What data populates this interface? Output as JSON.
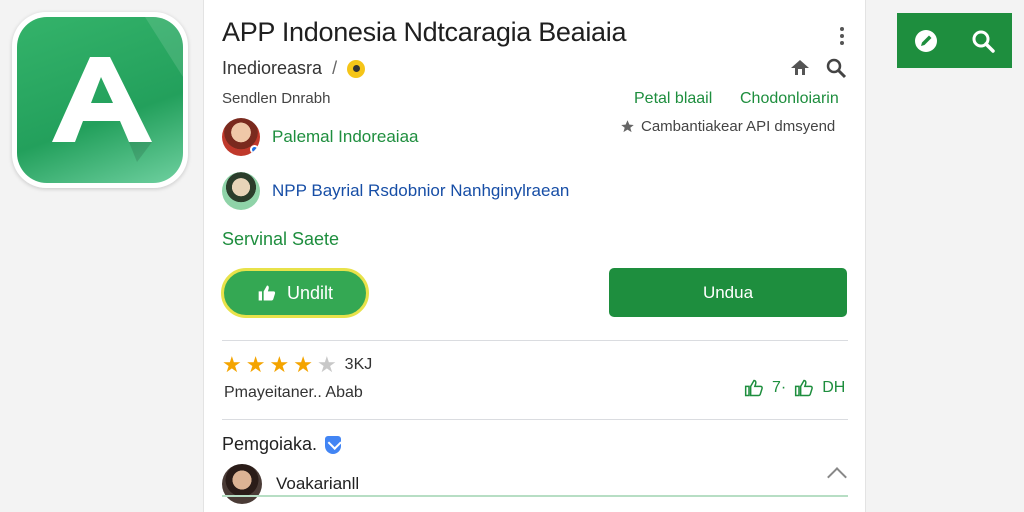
{
  "app": {
    "title": "APP Indonesia Ndtcaragia Beaiaia",
    "developer": "Inedioreasra",
    "developer_separator": "/",
    "sub_label": "Sendlen Dnrabh",
    "link_a": "Petal blaail",
    "link_b": "Chodonloiarin",
    "star_note": "Cambantiakear API dmsyend"
  },
  "people": [
    {
      "name": "Palemal Indoreaiaa"
    },
    {
      "name": "NPP Bayrial Rsdobnior Nanhginylraean"
    }
  ],
  "section": {
    "label": "Servinal Saete"
  },
  "buttons": {
    "secondary_label": "Undilt",
    "primary_label": "Undua"
  },
  "rating": {
    "stars_filled": 4,
    "stars_total": 5,
    "count": "3KJ",
    "review": "Pmayeitaner.. Abab",
    "vote_middle": "7·",
    "vote_count": "DH"
  },
  "comments": {
    "title": "Pemgoiaka.",
    "commenter": "Voakarianll"
  },
  "colors": {
    "accent": "#1e8e3e",
    "star": "#f4a400",
    "button_outline": "#e8e24a",
    "link_blue": "#174ea6"
  },
  "icons": [
    "app-logo-icon",
    "kebab-menu-icon",
    "developer-badge-icon",
    "share-icon",
    "search-icon",
    "star-icon",
    "thumbs-up-icon",
    "shield-icon",
    "chevron-up-icon",
    "edit-icon",
    "toolbar-search-icon"
  ]
}
